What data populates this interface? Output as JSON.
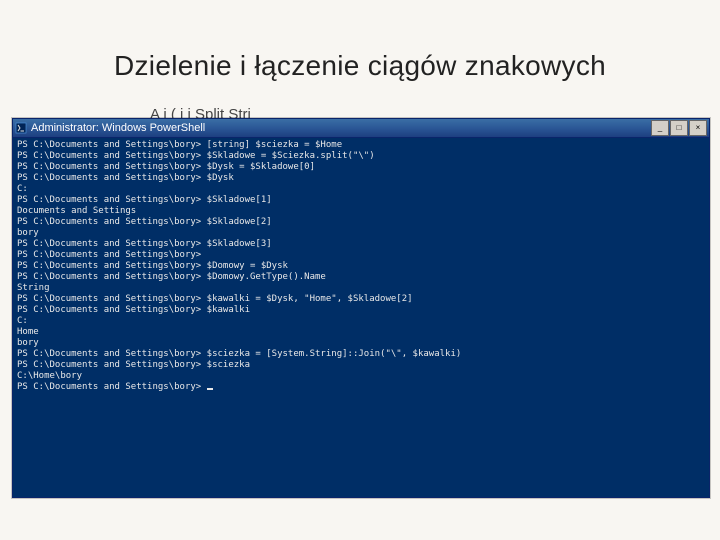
{
  "slide": {
    "title": "Dzielenie i łączenie ciągów znakowych",
    "subtitle_fragment": "A i (   i      i   Split  Stri"
  },
  "window": {
    "title": "Administrator: Windows PowerShell",
    "buttons": {
      "min": "_",
      "max": "□",
      "close": "×"
    }
  },
  "console": {
    "prompt": "PS C:\\Documents and Settings\\bory>",
    "lines": [
      "PS C:\\Documents and Settings\\bory> [string] $sciezka = $Home",
      "PS C:\\Documents and Settings\\bory> $Skladowe = $Sciezka.split(\"\\\")",
      "PS C:\\Documents and Settings\\bory> $Dysk = $Skladowe[0]",
      "PS C:\\Documents and Settings\\bory> $Dysk",
      "C:",
      "PS C:\\Documents and Settings\\bory> $Skladowe[1]",
      "Documents and Settings",
      "PS C:\\Documents and Settings\\bory> $Skladowe[2]",
      "bory",
      "PS C:\\Documents and Settings\\bory> $Skladowe[3]",
      "PS C:\\Documents and Settings\\bory>",
      "PS C:\\Documents and Settings\\bory> $Domowy = $Dysk",
      "PS C:\\Documents and Settings\\bory> $Domowy.GetType().Name",
      "String",
      "PS C:\\Documents and Settings\\bory> $kawalki = $Dysk, \"Home\", $Skladowe[2]",
      "PS C:\\Documents and Settings\\bory> $kawalki",
      "C:",
      "Home",
      "bory",
      "PS C:\\Documents and Settings\\bory> $sciezka = [System.String]::Join(\"\\\", $kawalki)",
      "PS C:\\Documents and Settings\\bory> $sciezka",
      "C:\\Home\\bory",
      "PS C:\\Documents and Settings\\bory> "
    ]
  }
}
